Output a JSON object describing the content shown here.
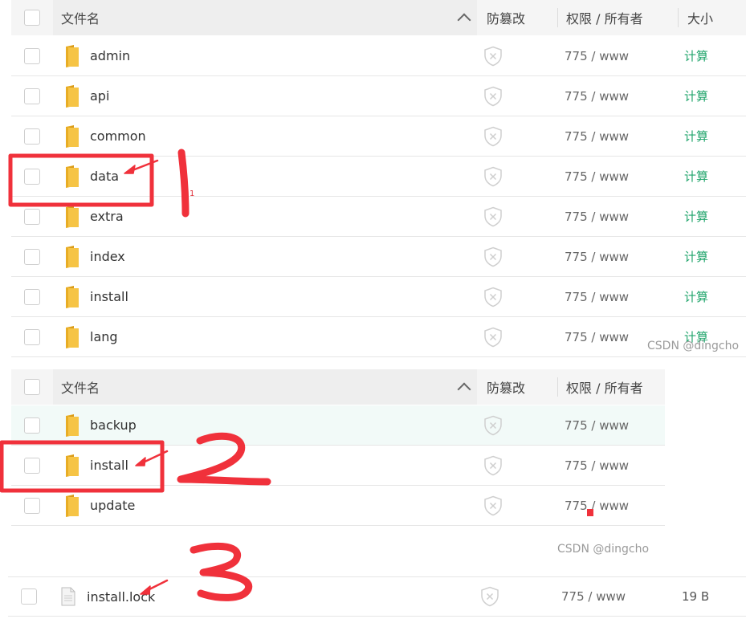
{
  "header": {
    "filename_label": "文件名",
    "tamper_label": "防篡改",
    "perm_label": "权限 / 所有者",
    "size_label": "大小"
  },
  "panel1": {
    "rows": [
      {
        "name": "admin",
        "perm": "775 / www",
        "size": "计算"
      },
      {
        "name": "api",
        "perm": "775 / www",
        "size": "计算"
      },
      {
        "name": "common",
        "perm": "775 / www",
        "size": "计算"
      },
      {
        "name": "data",
        "perm": "775 / www",
        "size": "计算"
      },
      {
        "name": "extra",
        "perm": "775 / www",
        "size": "计算"
      },
      {
        "name": "index",
        "perm": "775 / www",
        "size": "计算"
      },
      {
        "name": "install",
        "perm": "775 / www",
        "size": "计算"
      },
      {
        "name": "lang",
        "perm": "775 / www",
        "size": "计算"
      }
    ]
  },
  "panel2": {
    "rows": [
      {
        "name": "backup",
        "perm": "775 / www"
      },
      {
        "name": "install",
        "perm": "775 / www"
      },
      {
        "name": "update",
        "perm": "775 / www"
      }
    ]
  },
  "panel3": {
    "row": {
      "name": "install.lock",
      "perm": "775 / www",
      "size": "19 B"
    }
  },
  "watermark": "CSDN @dingcho",
  "annotations": {
    "small_label": "1"
  },
  "colors": {
    "folder": "#f6c445",
    "calc_green": "#21a56c",
    "annotation_red": "#f0313b",
    "highlight_row": "#f2faf8"
  }
}
